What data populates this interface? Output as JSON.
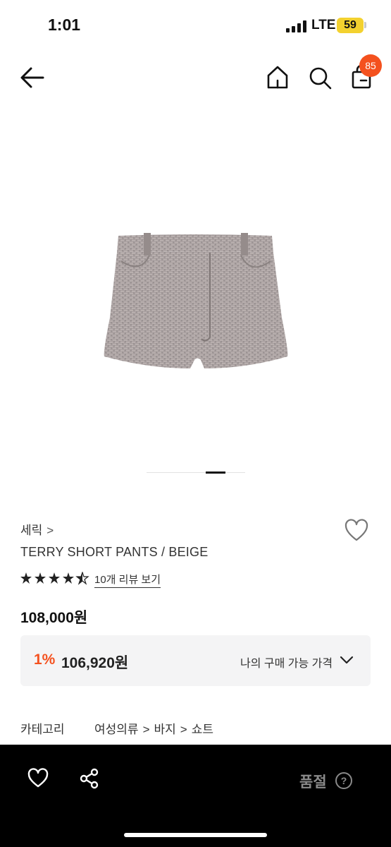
{
  "status_bar": {
    "time": "1:01",
    "network": "LTE",
    "battery": "59"
  },
  "header": {
    "back_icon": "arrow-left-icon",
    "home_icon": "home-icon",
    "search_icon": "search-icon",
    "cart_icon": "shopping-bag-icon",
    "cart_count": "85"
  },
  "product": {
    "image": "beige terry short pants",
    "image_pager": {
      "current": 3,
      "total": 5
    },
    "brand": "세릭",
    "brand_chevron": ">",
    "name": "TERRY SHORT PANTS / BEIGE",
    "rating": 4.5,
    "review_link": "10개 리뷰 보기",
    "price": "108,000원",
    "discount": {
      "rate": "1%",
      "price": "106,920원",
      "label": "나의 구매 가능 가격"
    },
    "category": {
      "label": "카테고리",
      "path": [
        "여성의류",
        "바지",
        "쇼트"
      ],
      "separator": ">"
    }
  },
  "bottom_bar": {
    "like_icon": "heart-icon",
    "share_icon": "share-icon",
    "status": "품절",
    "help": "?"
  },
  "colors": {
    "accent": "#f4511e",
    "bottom_bar_bg": "#000000",
    "price_box_bg": "#f4f4f5",
    "soldout_text": "#8a8a8a",
    "battery": "#f3d12f"
  }
}
